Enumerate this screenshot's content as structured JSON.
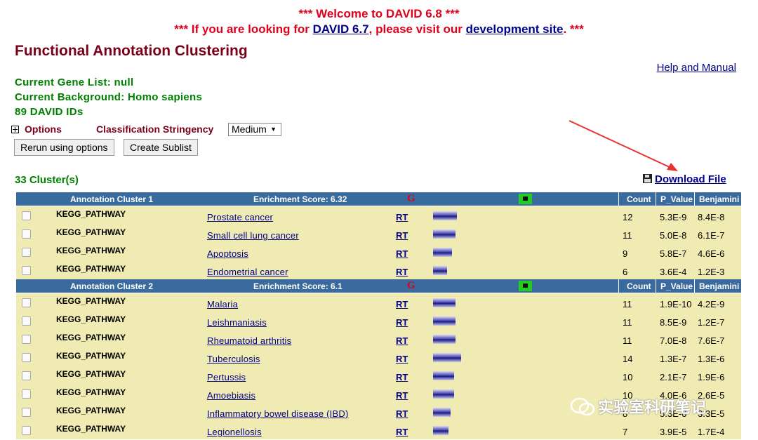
{
  "banner": {
    "line1": "*** Welcome to DAVID 6.8 ***",
    "line2_pre": "*** If you are looking for ",
    "line2_link1": "DAVID 6.7",
    "line2_mid": ", please visit our ",
    "line2_link2": "development site",
    "line2_post": ". ***"
  },
  "page_title": "Functional Annotation Clustering",
  "help_link": "Help and Manual",
  "gene_list": "Current Gene List: null",
  "background": "Current Background: Homo sapiens",
  "david_ids": "89 DAVID IDs",
  "options_label": "Options",
  "stringency_label": "Classification Stringency",
  "stringency_value": "Medium",
  "rerun_button": "Rerun using options",
  "sublist_button": "Create Sublist",
  "cluster_count": "33 Cluster(s)",
  "download_label": "Download File",
  "headers": {
    "count": "Count",
    "pvalue": "P_Value",
    "benjamini": "Benjamini",
    "g": "G"
  },
  "clusters": [
    {
      "name": "Annotation Cluster 1",
      "score": "Enrichment Score: 6.32",
      "rows": [
        {
          "category": "KEGG_PATHWAY",
          "term": "Prostate cancer",
          "rt": "RT",
          "bar": 0.85,
          "count": "12",
          "pvalue": "5.3E-9",
          "benjamini": "8.4E-8"
        },
        {
          "category": "KEGG_PATHWAY",
          "term": "Small cell lung cancer",
          "rt": "RT",
          "bar": 0.8,
          "count": "11",
          "pvalue": "5.0E-8",
          "benjamini": "6.1E-7"
        },
        {
          "category": "KEGG_PATHWAY",
          "term": "Apoptosis",
          "rt": "RT",
          "bar": 0.68,
          "count": "9",
          "pvalue": "5.8E-7",
          "benjamini": "4.6E-6"
        },
        {
          "category": "KEGG_PATHWAY",
          "term": "Endometrial cancer",
          "rt": "RT",
          "bar": 0.5,
          "count": "6",
          "pvalue": "3.6E-4",
          "benjamini": "1.2E-3"
        }
      ]
    },
    {
      "name": "Annotation Cluster 2",
      "score": "Enrichment Score: 6.1",
      "rows": [
        {
          "category": "KEGG_PATHWAY",
          "term": "Malaria",
          "rt": "RT",
          "bar": 0.8,
          "count": "11",
          "pvalue": "1.9E-10",
          "benjamini": "4.2E-9"
        },
        {
          "category": "KEGG_PATHWAY",
          "term": "Leishmaniasis",
          "rt": "RT",
          "bar": 0.8,
          "count": "11",
          "pvalue": "8.5E-9",
          "benjamini": "1.2E-7"
        },
        {
          "category": "KEGG_PATHWAY",
          "term": "Rheumatoid arthritis",
          "rt": "RT",
          "bar": 0.8,
          "count": "11",
          "pvalue": "7.0E-8",
          "benjamini": "7.6E-7"
        },
        {
          "category": "KEGG_PATHWAY",
          "term": "Tuberculosis",
          "rt": "RT",
          "bar": 1.0,
          "count": "14",
          "pvalue": "1.3E-7",
          "benjamini": "1.3E-6"
        },
        {
          "category": "KEGG_PATHWAY",
          "term": "Pertussis",
          "rt": "RT",
          "bar": 0.75,
          "count": "10",
          "pvalue": "2.1E-7",
          "benjamini": "1.9E-6"
        },
        {
          "category": "KEGG_PATHWAY",
          "term": "Amoebiasis",
          "rt": "RT",
          "bar": 0.75,
          "count": "10",
          "pvalue": "4.0E-6",
          "benjamini": "2.6E-5"
        },
        {
          "category": "KEGG_PATHWAY",
          "term": "Inflammatory bowel disease (IBD)",
          "rt": "RT",
          "bar": 0.62,
          "count": "8",
          "pvalue": "5.3E-6",
          "benjamini": "3.3E-5"
        },
        {
          "category": "KEGG_PATHWAY",
          "term": "Legionellosis",
          "rt": "RT",
          "bar": 0.55,
          "count": "7",
          "pvalue": "3.9E-5",
          "benjamini": "1.7E-4"
        }
      ]
    }
  ],
  "watermark": "实验室科研笔记"
}
